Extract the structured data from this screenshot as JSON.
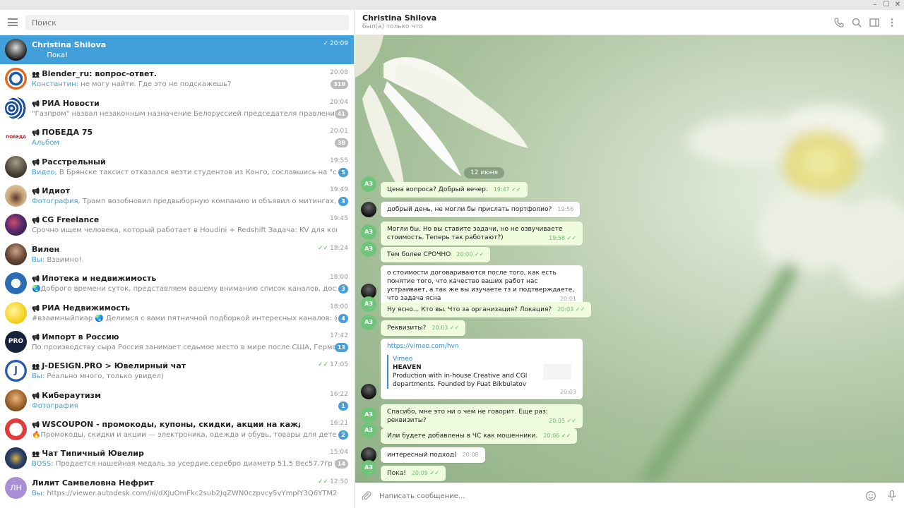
{
  "left": {
    "search_placeholder": "Поиск",
    "chats": [
      {
        "name": "Christina Shilova",
        "type": "user",
        "time": "20:09",
        "read": true,
        "sender": "Вы:",
        "preview": "Пока!",
        "badge": "",
        "active": true
      },
      {
        "name": "Blender_ru: вопрос-ответ.",
        "type": "group",
        "time": "20:08",
        "sender": "Константин:",
        "preview": "не могу найти. Где это не подскажешь?",
        "badge": "319",
        "badge_color": "grey"
      },
      {
        "name": "РИА Новости",
        "type": "channel",
        "time": "20:04",
        "sender": "",
        "preview": "\"Газпром\" назвал незаконным назначение Белоруссией председателя правления Белгазпромбанка, ...",
        "badge": "41",
        "badge_color": "grey"
      },
      {
        "name": "ПОБЕДА 75",
        "type": "channel",
        "time": "20:01",
        "sender": "Альбом",
        "preview": "",
        "badge": "38",
        "badge_color": "grey"
      },
      {
        "name": "Расстрельный",
        "type": "channel",
        "time": "19:55",
        "sender": "Видео,",
        "preview": "В Брянске таксист отказался везти студентов из Конго, сославшись на \"состояние\" одного из ни...",
        "badge": "5",
        "badge_color": "blue"
      },
      {
        "name": "Идиот",
        "type": "channel",
        "time": "19:49",
        "sender": "Фотография,",
        "preview": "Трамп возобновил предвыборную компанию и объявил о митингах, посетить которые ...",
        "badge": "3",
        "badge_color": "blue"
      },
      {
        "name": "CG Freelance",
        "type": "channel",
        "time": "19:45",
        "sender": "",
        "preview": "Срочно ищем человека, который работает в Houdini + Redshift   Задача:  KV для консервов, фотоил  Нуж...",
        "badge": "",
        "badge_color": ""
      },
      {
        "name": "Вилен",
        "type": "user",
        "time": "18:24",
        "read": true,
        "sender": "Вы:",
        "preview": "Взаимно!",
        "badge": ""
      },
      {
        "name": "Ипотека и недвижимость",
        "type": "channel",
        "time": "18:00",
        "sender": "",
        "preview": "🌏Доброго времени суток, представляем вашему вниманию список каналов,  достойных вашего вни...",
        "badge": "3",
        "badge_color": "blue"
      },
      {
        "name": "РИА Недвижимость",
        "type": "channel",
        "time": "18:00",
        "sender": "",
        "preview": "#взаимныйпиар 🌏 Делимся с вами пятничной подборкой интересных каналов:  @real_estate - Канал ...",
        "badge": "4",
        "badge_color": "blue"
      },
      {
        "name": "Импорт в Россию",
        "type": "channel",
        "time": "17:42",
        "sender": "",
        "preview": "По производству сыра Россия занимает седьмое место в мире после США, Германии, Франции, Итали...",
        "badge": "13",
        "badge_color": "blue"
      },
      {
        "name": "J-DESIGN.PRO > Ювелирный чат",
        "type": "group",
        "time": "17:05",
        "read": true,
        "sender": "Вы:",
        "preview": "Реально много, только увидел)",
        "badge": ""
      },
      {
        "name": "Кибераутизм",
        "type": "channel",
        "time": "16:22",
        "sender": "Фотография",
        "preview": "",
        "badge": "1",
        "badge_color": "blue"
      },
      {
        "name": "WSCOUPON - промокоды, купоны, скидки, акции на каждый день!",
        "type": "channel",
        "time": "16:21",
        "sender": "",
        "preview": "🔥Промокоды, скидки и акции — электроника, одежда и обувь, товары для детей, кино, игры...",
        "badge": "2",
        "badge_color": "blue"
      },
      {
        "name": "Чат Типичный Ювелир",
        "type": "group",
        "time": "15:04",
        "sender": "BOSS:",
        "preview": "Продается нашейная медаль за усердие.серебро диаметр 51.5  Вес57.7гр  Кого интересует писа...",
        "badge": "14",
        "badge_color": "grey"
      },
      {
        "name": "Лилит Самвеловна Нефрит",
        "type": "user",
        "time": "12:50",
        "read": true,
        "sender": "Вы:",
        "preview": "https://viewer.autodesk.com/id/dXJuOmFkc2sub2JqZWN0czpvcy5vYmplY3Q6YTM2MHZpZXdlci90MTU5MTk...",
        "badge": "",
        "initials": "ЛН"
      }
    ]
  },
  "right": {
    "peer_name": "Christina Shilova",
    "peer_status": "был(а) только что",
    "date_label": "12 июня",
    "my_initials": "АЗ",
    "messages": [
      {
        "dir": "out",
        "text": "Цена вопроса? Добрый вечер.",
        "time": "19:47"
      },
      {
        "dir": "in",
        "text": "добрый день, не могли бы прислать портфолио?",
        "time": "19:56"
      },
      {
        "dir": "out",
        "text": "Могли бы. Но вы ставите задачи, но не озвучиваете стоимость. Теперь так работают?)",
        "time": "19:58"
      },
      {
        "dir": "out",
        "text": "Тем более СРОЧНО",
        "time": "20:00"
      },
      {
        "dir": "in",
        "text": "о стоимости договариваются после того, как есть понятие того, что качество ваших работ нас устраивает, а так же вы изучаете тз и подтверждаете, что задача ясна",
        "time": "20:01"
      },
      {
        "dir": "out",
        "text": "Ну ясно... Кто вы. Что за организация? Локация?",
        "time": "20:03"
      },
      {
        "dir": "out",
        "text": "Реквизиты?",
        "time": "20:03"
      },
      {
        "dir": "in",
        "link": "https://vimeo.com/hvn",
        "site": "Vimeo",
        "title": "HEAVEN",
        "desc": "Production with in-house Creative and CGI departments.  Founded by Fuat Bikbulatov",
        "time": "20:03"
      },
      {
        "dir": "out",
        "text": "Спасибо, мне это ни о чем не говорит. Еще раз: реквизиты?",
        "time": "20:05"
      },
      {
        "dir": "out",
        "text": "Или будете добавлены в ЧС как мошенники.",
        "time": "20:06"
      },
      {
        "dir": "in",
        "text": "интересный подход)",
        "time": "20:08"
      },
      {
        "dir": "out",
        "text": "Пока!",
        "time": "20:09"
      }
    ],
    "composer_placeholder": "Написать сообщение..."
  },
  "colors": {
    "accent": "#419fd9",
    "out_bubble": "#effdde",
    "check": "#4eb85a"
  }
}
